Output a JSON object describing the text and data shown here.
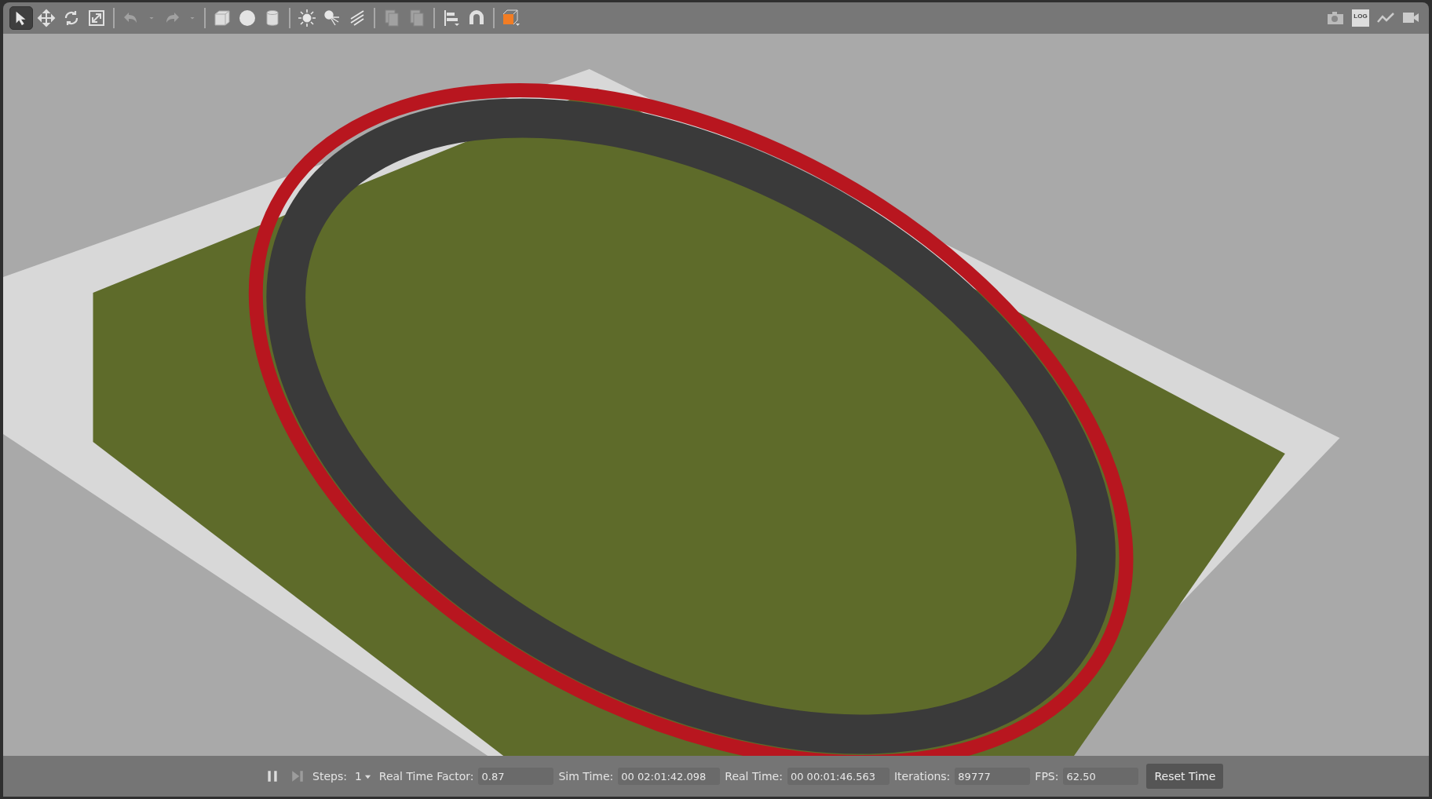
{
  "toolbar": {
    "tools": [
      {
        "kind": "select",
        "selected": true,
        "disabled": false
      },
      {
        "kind": "translate",
        "selected": false,
        "disabled": false
      },
      {
        "kind": "rotate",
        "selected": false,
        "disabled": false
      },
      {
        "kind": "scale",
        "selected": false,
        "disabled": false
      },
      {
        "kind": "sep"
      },
      {
        "kind": "undo",
        "selected": false,
        "disabled": true
      },
      {
        "kind": "dropdown",
        "selected": false,
        "disabled": true
      },
      {
        "kind": "redo",
        "selected": false,
        "disabled": true
      },
      {
        "kind": "dropdown",
        "selected": false,
        "disabled": true
      },
      {
        "kind": "sep"
      },
      {
        "kind": "box",
        "selected": false,
        "disabled": false
      },
      {
        "kind": "sphere",
        "selected": false,
        "disabled": false
      },
      {
        "kind": "cylinder",
        "selected": false,
        "disabled": false
      },
      {
        "kind": "sep"
      },
      {
        "kind": "sun",
        "selected": false,
        "disabled": false
      },
      {
        "kind": "spot",
        "selected": false,
        "disabled": false
      },
      {
        "kind": "directional",
        "selected": false,
        "disabled": false
      },
      {
        "kind": "sep"
      },
      {
        "kind": "copy",
        "selected": false,
        "disabled": true
      },
      {
        "kind": "paste",
        "selected": false,
        "disabled": true
      },
      {
        "kind": "sep"
      },
      {
        "kind": "align",
        "selected": false,
        "disabled": false
      },
      {
        "kind": "magnet",
        "selected": false,
        "disabled": false
      },
      {
        "kind": "sep"
      },
      {
        "kind": "view",
        "selected": false,
        "disabled": false
      }
    ],
    "right_tools": [
      {
        "kind": "camera"
      },
      {
        "kind": "log",
        "label": "LOG"
      },
      {
        "kind": "plot"
      },
      {
        "kind": "video"
      }
    ]
  },
  "status_bar": {
    "steps_label": "Steps:",
    "steps_value": "1",
    "fields": [
      {
        "label": "Real Time Factor:",
        "value": "0.87"
      },
      {
        "label": "Sim Time:",
        "value": "00 02:01:42.098"
      },
      {
        "label": "Real Time:",
        "value": "00 00:01:46.563"
      },
      {
        "label": "Iterations:",
        "value": "89777"
      },
      {
        "label": "FPS:",
        "value": "62.50"
      }
    ],
    "reset_button": "Reset Time"
  }
}
